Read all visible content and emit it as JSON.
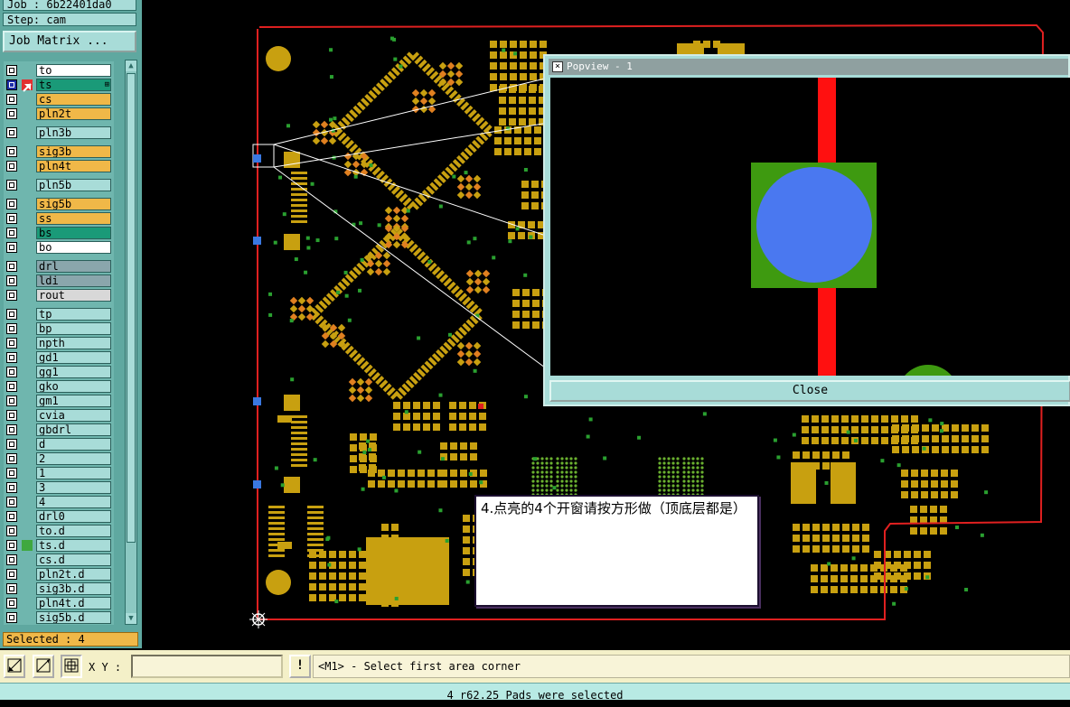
{
  "header": {
    "job": "Job : 6b22401da0",
    "step": "Step: cam"
  },
  "job_matrix_label": "Job Matrix ...",
  "groups": [
    [
      {
        "name": "to",
        "color": "#ffffff"
      },
      {
        "name": "ts",
        "color": "#1a9a78",
        "active": true,
        "note": "⊞"
      },
      {
        "name": "cs",
        "color": "#f0b848"
      },
      {
        "name": "pln2t",
        "color": "#f0b848"
      }
    ],
    [
      {
        "name": "pln3b",
        "color": "#a8dcd8"
      }
    ],
    [
      {
        "name": "sig3b",
        "color": "#f0b848"
      },
      {
        "name": "pln4t",
        "color": "#f0b848"
      }
    ],
    [
      {
        "name": "pln5b",
        "color": "#a8dcd8"
      }
    ],
    [
      {
        "name": "sig5b",
        "color": "#f0b848"
      },
      {
        "name": "ss",
        "color": "#f0b848"
      },
      {
        "name": "bs",
        "color": "#1a9a78"
      },
      {
        "name": "bo",
        "color": "#ffffff"
      }
    ],
    [
      {
        "name": "drl",
        "color": "#8aa6ac"
      },
      {
        "name": "ldi",
        "color": "#8aa6ac"
      },
      {
        "name": "rout",
        "color": "#d8d8d8"
      }
    ],
    [
      {
        "name": "tp",
        "color": "#a8dcd8"
      },
      {
        "name": "bp",
        "color": "#a8dcd8"
      },
      {
        "name": "npth",
        "color": "#a8dcd8"
      },
      {
        "name": "gd1",
        "color": "#a8dcd8"
      },
      {
        "name": "gg1",
        "color": "#a8dcd8"
      },
      {
        "name": "gko",
        "color": "#a8dcd8"
      },
      {
        "name": "gm1",
        "color": "#a8dcd8"
      },
      {
        "name": "cvia",
        "color": "#a8dcd8"
      },
      {
        "name": "gbdrl",
        "color": "#a8dcd8"
      },
      {
        "name": "d",
        "color": "#a8dcd8"
      },
      {
        "name": "2",
        "color": "#a8dcd8"
      },
      {
        "name": "1",
        "color": "#a8dcd8"
      },
      {
        "name": "3",
        "color": "#a8dcd8"
      },
      {
        "name": "4",
        "color": "#a8dcd8"
      },
      {
        "name": "drl0",
        "color": "#a8dcd8"
      },
      {
        "name": "to.d",
        "color": "#a8dcd8"
      },
      {
        "name": "ts.d",
        "color": "#a8dcd8",
        "mark": true
      },
      {
        "name": "cs.d",
        "color": "#a8dcd8"
      },
      {
        "name": "pln2t.d",
        "color": "#a8dcd8"
      },
      {
        "name": "sig3b.d",
        "color": "#a8dcd8"
      },
      {
        "name": "pln4t.d",
        "color": "#a8dcd8"
      },
      {
        "name": "sig5b.d",
        "color": "#a8dcd8"
      }
    ]
  ],
  "selected_text": "Selected : 4",
  "popview": {
    "title": "Popview - 1",
    "close_label": "Close"
  },
  "note_text": "4.点亮的4个开窗请按方形做（顶底层都是）",
  "bottom": {
    "xy_label": "X Y :",
    "xy_value": "",
    "excl_label": "!",
    "prompt": "<M1> - Select first area corner",
    "status": "4 r62.25 Pads were selected"
  },
  "colors": {
    "board_outline": "#e02020",
    "pad": "#c8a010",
    "pad_orange": "#e08020",
    "via": "#2aa030",
    "selection": "#3a78e0"
  }
}
